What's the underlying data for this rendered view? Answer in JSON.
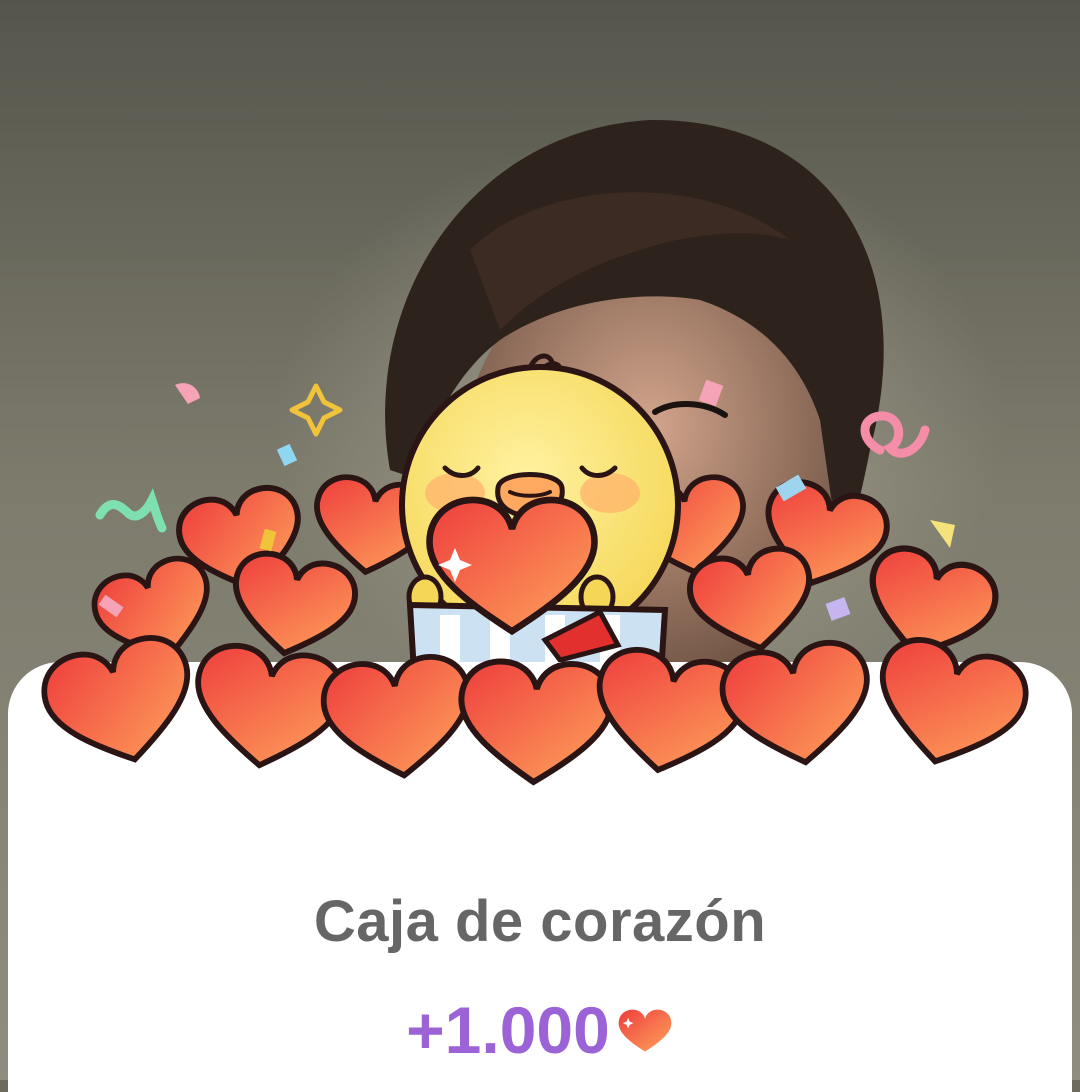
{
  "reward_card": {
    "title": "Caja de corazón",
    "amount": "+1.000",
    "currency_icon": "heart-icon"
  },
  "illustration": {
    "character": "yellow-chick-holding-heart",
    "contents": "pile-of-hearts-with-confetti"
  },
  "colors": {
    "title_text": "#666666",
    "amount_text": "#9b63d6",
    "heart_light": "#ffaa5e",
    "heart_dark": "#ee3d3d",
    "chick": "#fbe577",
    "card": "#ffffff"
  }
}
